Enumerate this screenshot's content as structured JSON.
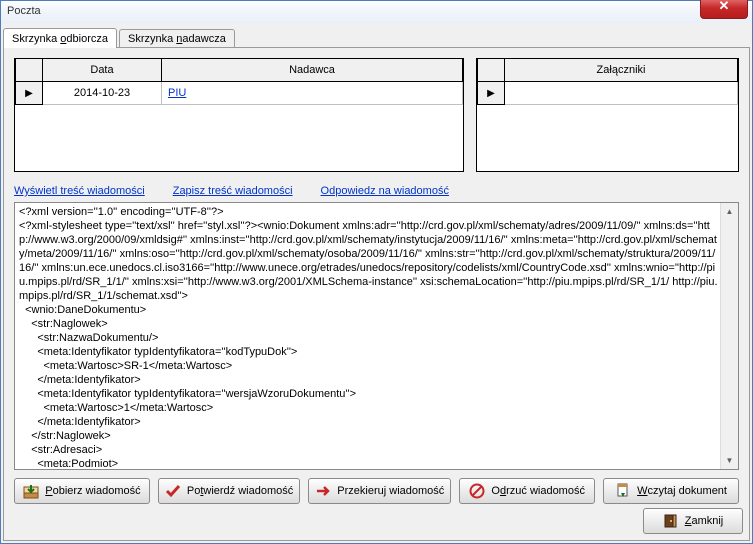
{
  "window": {
    "title": "Poczta"
  },
  "tabs": {
    "inbox": "Skrzynka odbiorcza",
    "outbox": "Skrzynka nadawcza"
  },
  "grid_left": {
    "col_data": "Data",
    "col_sender": "Nadawca",
    "rows": [
      {
        "date": "2014-10-23",
        "sender": "PIU"
      }
    ]
  },
  "grid_right": {
    "col_attach": "Załączniki"
  },
  "links": {
    "show": "Wyświetl treść wiadomości",
    "save": "Zapisz treść wiadomości",
    "reply": "Odpowiedz na wiadomość"
  },
  "xml_content": "<?xml version=''1.0'' encoding=''UTF-8''?>\n<?xml-stylesheet type=''text/xsl'' href=''styl.xsl''?><wnio:Dokument xmlns:adr=''http://crd.gov.pl/xml/schematy/adres/2009/11/09/'' xmlns:ds=''http://www.w3.org/2000/09/xmldsig#'' xmlns:inst=''http://crd.gov.pl/xml/schematy/instytucja/2009/11/16/'' xmlns:meta=''http://crd.gov.pl/xml/schematy/meta/2009/11/16/'' xmlns:oso=''http://crd.gov.pl/xml/schematy/osoba/2009/11/16/'' xmlns:str=''http://crd.gov.pl/xml/schematy/struktura/2009/11/16/'' xmlns:un.ece.unedocs.cl.iso3166=''http://www.unece.org/etrades/unedocs/repository/codelists/xml/CountryCode.xsd'' xmlns:wnio=''http://piu.mpips.pl/rd/SR_1/1/'' xmlns:xsi=''http://www.w3.org/2001/XMLSchema-instance'' xsi:schemaLocation=''http://piu.mpips.pl/rd/SR_1/1/ http://piu.mpips.pl/rd/SR_1/1/schemat.xsd''>\n  <wnio:DaneDokumentu>\n    <str:Naglowek>\n      <str:NazwaDokumentu/>\n      <meta:Identyfikator typIdentyfikatora=''kodTypuDok''>\n        <meta:Wartosc>SR-1</meta:Wartosc>\n      </meta:Identyfikator>\n      <meta:Identyfikator typIdentyfikatora=''wersjaWzoruDokumentu''>\n        <meta:Wartosc>1</meta:Wartosc>\n      </meta:Identyfikator>\n    </str:Naglowek>\n    <str:Adresaci>\n      <meta:Podmiot>",
  "buttons": {
    "download": "Pobierz wiadomość",
    "confirm": "Potwierdź wiadomość",
    "forward": "Przekieruj wiadomość",
    "reject": "Odrzuć wiadomość",
    "load": "Wczytaj dokument",
    "close": "Zamknij"
  }
}
